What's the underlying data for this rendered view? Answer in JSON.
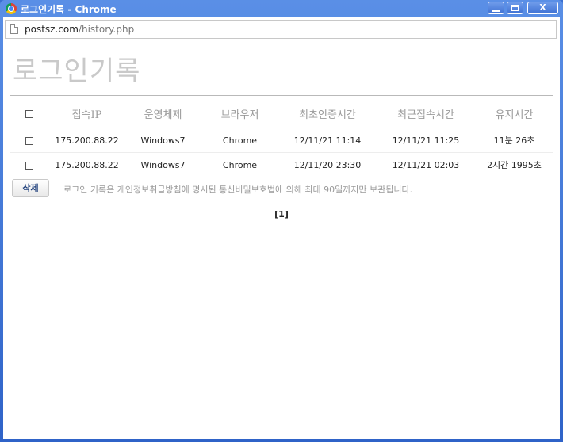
{
  "window": {
    "title": "로그인기록 - Chrome",
    "minimize": "",
    "maximize": "",
    "close": "X"
  },
  "address": {
    "host": "postsz.com",
    "path": "/history.php"
  },
  "page": {
    "title": "로그인기록"
  },
  "table": {
    "headers": [
      "접속IP",
      "운영체제",
      "브라우저",
      "최초인증시간",
      "최근접속시간",
      "유지시간"
    ],
    "rows": [
      {
        "ip": "175.200.88.22",
        "os": "Windows7",
        "browser": "Chrome",
        "first": "12/11/21 11:14",
        "last": "12/11/21 11:25",
        "duration": "11분 26초"
      },
      {
        "ip": "175.200.88.22",
        "os": "Windows7",
        "browser": "Chrome",
        "first": "12/11/20 23:30",
        "last": "12/11/21 02:03",
        "duration": "2시간 1995초"
      }
    ]
  },
  "actions": {
    "delete_label": "삭제",
    "notice": "로그인 기록은 개인정보취급방침에 명시된 통신비밀보호법에 의해 최대 90일까지만 보관됩니다."
  },
  "pagination": {
    "current": "[1]"
  }
}
